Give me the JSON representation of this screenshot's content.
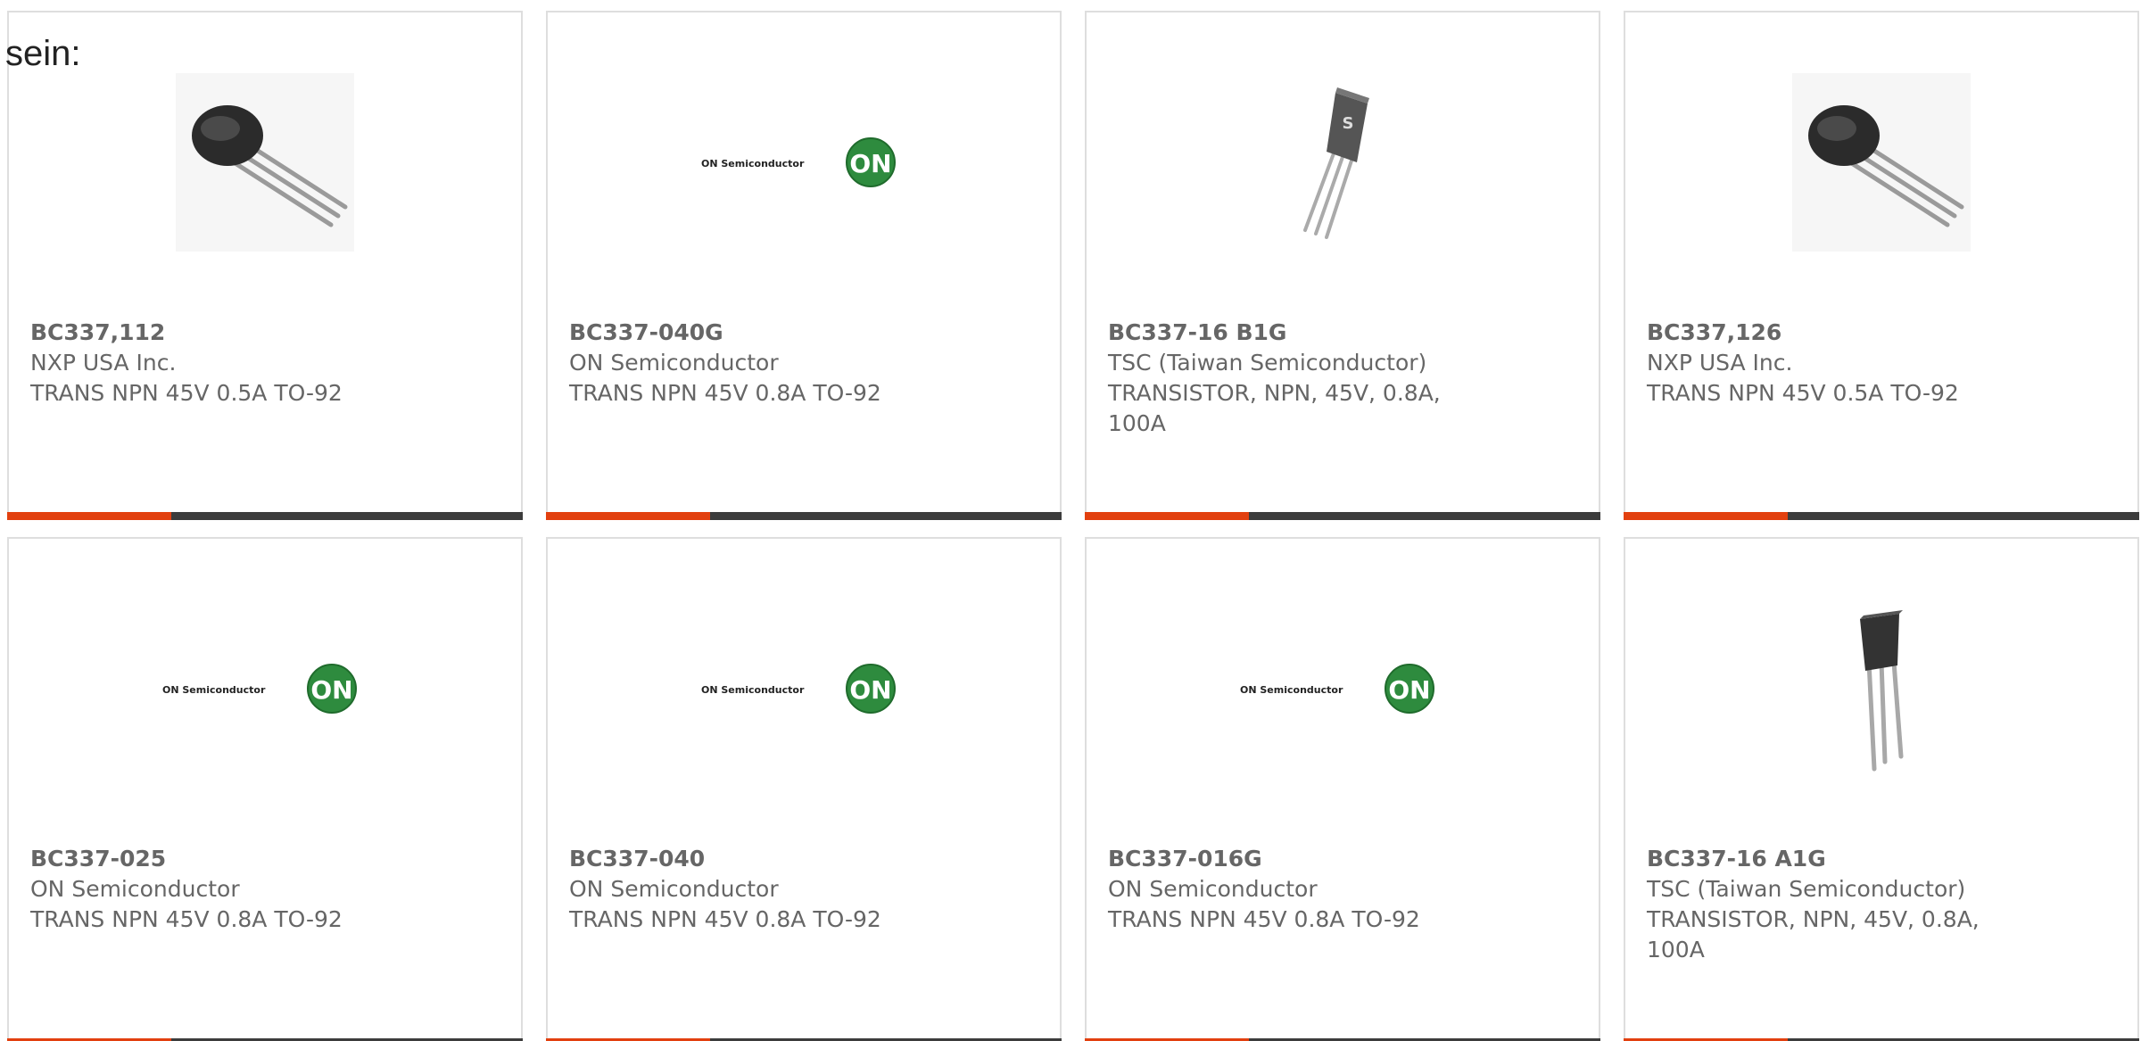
{
  "intro_text": "sein:",
  "colors": {
    "accent": "#e2400f",
    "bar": "#3c3c3c",
    "text": "#666666",
    "border": "#dedede",
    "on_logo_green": "#2e8b3e"
  },
  "products": [
    {
      "part_number": "BC337,112",
      "manufacturer": "NXP USA Inc.",
      "description": "TRANS NPN 45V 0.5A TO-92",
      "image": "to92-transistor-photo"
    },
    {
      "part_number": "BC337-040G",
      "manufacturer": "ON Semiconductor",
      "description": "TRANS NPN 45V 0.8A TO-92",
      "image": "on-semiconductor-logo",
      "logo_text": "ON Semiconductor",
      "logo_badge": "ON"
    },
    {
      "part_number": "BC337-16 B1G",
      "manufacturer": "TSC (Taiwan Semiconductor)",
      "description": "TRANSISTOR, NPN, 45V, 0.8A, 100A",
      "image": "tsc-transistor-photo"
    },
    {
      "part_number": "BC337,126",
      "manufacturer": "NXP USA Inc.",
      "description": "TRANS NPN 45V 0.5A TO-92",
      "image": "to92-transistor-photo"
    },
    {
      "part_number": "BC337-025",
      "manufacturer": "ON Semiconductor",
      "description": "TRANS NPN 45V 0.8A TO-92",
      "image": "on-semiconductor-logo",
      "logo_text": "ON Semiconductor",
      "logo_badge": "ON"
    },
    {
      "part_number": "BC337-040",
      "manufacturer": "ON Semiconductor",
      "description": "TRANS NPN 45V 0.8A TO-92",
      "image": "on-semiconductor-logo",
      "logo_text": "ON Semiconductor",
      "logo_badge": "ON"
    },
    {
      "part_number": "BC337-016G",
      "manufacturer": "ON Semiconductor",
      "description": "TRANS NPN 45V 0.8A TO-92",
      "image": "on-semiconductor-logo",
      "logo_text": "ON Semiconductor",
      "logo_badge": "ON"
    },
    {
      "part_number": "BC337-16 A1G",
      "manufacturer": "TSC (Taiwan Semiconductor)",
      "description": "TRANSISTOR, NPN, 45V, 0.8A, 100A",
      "image": "tsc-straight-transistor-photo"
    }
  ]
}
